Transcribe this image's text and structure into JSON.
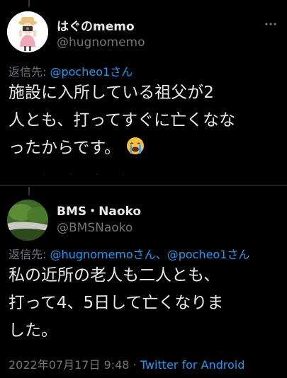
{
  "tweet1": {
    "display_name": "はぐのmemo",
    "handle": "@hugnomemo",
    "more_icon": "more-dots-icon",
    "reply_prefix": "返信先: ",
    "reply_mentions": [
      "@pocheo1さん"
    ],
    "text_lines": [
      "施設に入所している祖父が2",
      "人とも、打ってすぐに亡くなな",
      "ったからです。"
    ],
    "emoji": "loudly-crying-face"
  },
  "tweet2": {
    "display_name": "BMS・Naoko",
    "handle": "@BMSNaoko",
    "reply_prefix": "返信先: ",
    "reply_mentions": [
      "@hugnomemoさん",
      "、",
      "@pocheo1さん"
    ],
    "text_lines": [
      "私の近所の老人も二人とも、",
      "打って4、5日して亡くなりま",
      "した。"
    ],
    "timestamp": "2022年07月17日 9:48",
    "separator": " · ",
    "source": "Twitter for Android"
  },
  "colors": {
    "background": "#000000",
    "text": "#e7e9ea",
    "secondary": "#71767b",
    "link": "#1d9bf0"
  }
}
